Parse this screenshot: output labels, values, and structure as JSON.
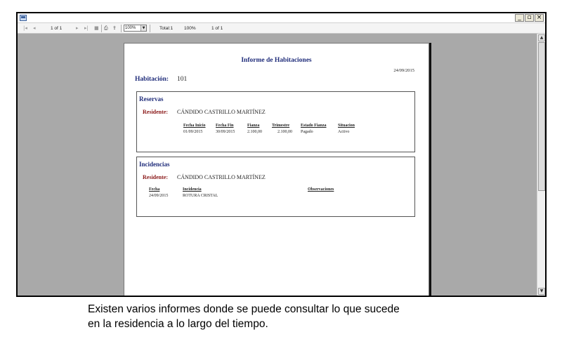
{
  "toolbar": {
    "first_icon": "first-page-icon",
    "prev_icon": "previous-page-icon",
    "page_indicator": "1 of 1",
    "next_icon": "next-page-icon",
    "last_icon": "last-page-icon",
    "stop_icon": "stop-icon",
    "print_icon": "printer-icon",
    "export_icon": "export-icon",
    "zoom_value": "100%",
    "total_label": "Total:1",
    "zoom_status": "100%",
    "page_status": "1 of 1"
  },
  "window_buttons": {
    "minimize": "_",
    "restore": "▫",
    "close": "×"
  },
  "report": {
    "title": "Informe de Habitaciones",
    "date": "24/09/2015",
    "habitacion_label": "Habitación:",
    "habitacion_value": "101",
    "reservas": {
      "title": "Reservas",
      "residente_label": "Residente:",
      "residente_value": "CÁNDIDO CASTRILLO MARTÍNEZ",
      "columns": [
        "Fecha Inicio",
        "Fecha Fin",
        "Fianza",
        "Trimestre",
        "Estado Fianza",
        "Situacion"
      ],
      "rows": [
        [
          "01/09/2015",
          "30/09/2015",
          "2.100,00",
          "2.100,00",
          "Pagado",
          "Activo"
        ]
      ]
    },
    "incidencias": {
      "title": "Incidencias",
      "residente_label": "Residente:",
      "residente_value": "CÁNDIDO CASTRILLO MARTÍNEZ",
      "columns": [
        "Fecha",
        "Incidencia",
        "Observaciones"
      ],
      "rows": [
        [
          "24/09/2015",
          "ROTURA CRISTAL",
          ""
        ]
      ]
    }
  },
  "caption": {
    "line1": "Existen varios informes donde se puede consultar lo que sucede",
    "line2": "en la residencia a lo largo del tiempo."
  }
}
